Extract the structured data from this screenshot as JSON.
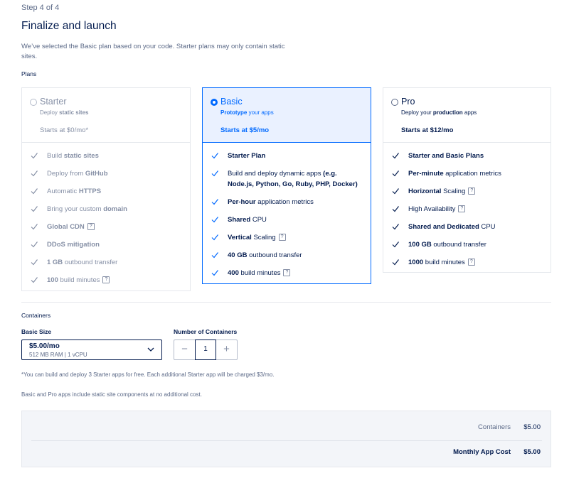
{
  "header": {
    "step": "Step 4 of 4",
    "title": "Finalize and launch",
    "description": "We’ve selected the Basic plan based on your code. Starter plans may only contain static sites.",
    "plans_label": "Plans"
  },
  "plans": [
    {
      "name": "Starter",
      "sub_pre": "Deploy ",
      "sub_bold": "static sites",
      "price": "Starts at $0/mo*",
      "state": "disabled",
      "features": [
        {
          "pre": "Build ",
          "bold": "static sites",
          "post": "",
          "help": false
        },
        {
          "pre": "Deploy from ",
          "bold": "GitHub",
          "post": "",
          "help": false
        },
        {
          "pre": "Automatic ",
          "bold": "HTTPS",
          "post": "",
          "help": false
        },
        {
          "pre": "Bring your custom ",
          "bold": "domain",
          "post": "",
          "help": false
        },
        {
          "pre": "",
          "bold": "Global CDN",
          "post": "",
          "help": true
        },
        {
          "pre": "",
          "bold": "DDoS mitigation",
          "post": "",
          "help": false
        },
        {
          "pre": "",
          "bold": "1 GB",
          "post": " outbound transfer",
          "help": false
        },
        {
          "pre": "",
          "bold": "100",
          "post": " build minutes",
          "help": true
        }
      ]
    },
    {
      "name": "Basic",
      "sub_pre": "",
      "sub_bold": "Prototype",
      "sub_post": " your apps",
      "price": "Starts at $5/mo",
      "state": "selected",
      "features": [
        {
          "pre": "",
          "bold": "Starter Plan",
          "post": "",
          "help": false
        },
        {
          "pre": "Build and deploy dynamic apps ",
          "bold": "(e.g. Node.js, Python, Go, Ruby, PHP, Docker)",
          "post": "",
          "help": false
        },
        {
          "pre": "",
          "bold": "Per-hour",
          "post": " application metrics",
          "help": false
        },
        {
          "pre": "",
          "bold": "Shared",
          "post": " CPU",
          "help": false
        },
        {
          "pre": "",
          "bold": "Vertical",
          "post": " Scaling",
          "help": true
        },
        {
          "pre": "",
          "bold": "40 GB",
          "post": " outbound transfer",
          "help": false
        },
        {
          "pre": "",
          "bold": "400",
          "post": " build minutes",
          "help": true
        }
      ]
    },
    {
      "name": "Pro",
      "sub_pre": "Deploy your ",
      "sub_bold": "production",
      "sub_post": " apps",
      "price": "Starts at $12/mo",
      "state": "normal",
      "features": [
        {
          "pre": "",
          "bold": "Starter and Basic Plans",
          "post": "",
          "help": false
        },
        {
          "pre": "",
          "bold": "Per-minute",
          "post": " application metrics",
          "help": false
        },
        {
          "pre": "",
          "bold": "Horizontal",
          "post": " Scaling",
          "help": true
        },
        {
          "pre": "High Availability",
          "bold": "",
          "post": "",
          "help": true
        },
        {
          "pre": "",
          "bold": "Shared and Dedicated",
          "post": " CPU",
          "help": false
        },
        {
          "pre": "",
          "bold": "100 GB",
          "post": " outbound transfer",
          "help": false
        },
        {
          "pre": "",
          "bold": "1000",
          "post": " build minutes",
          "help": true
        }
      ]
    }
  ],
  "containers": {
    "label": "Containers",
    "size_label": "Basic Size",
    "size_price": "$5.00/mo",
    "size_spec": "512 MB RAM | 1 vCPU",
    "num_label": "Number of Containers",
    "num_value": "1",
    "minus": "−",
    "plus": "+"
  },
  "notes": {
    "note1": "*You can build and deploy 3 Starter apps for free. Each additional Starter app will be charged $3/mo.",
    "note2": "Basic and Pro apps include static site components at no additional cost."
  },
  "summary": {
    "containers_label": "Containers",
    "containers_value": "$5.00",
    "monthly_label": "Monthly App Cost",
    "monthly_value": "$5.00"
  },
  "colors": {
    "accent": "#0069ff",
    "text": "#031b4e",
    "muted": "#8690a6"
  }
}
